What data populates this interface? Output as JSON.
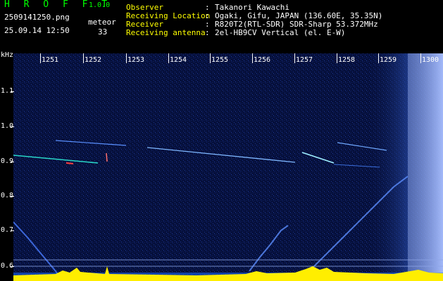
{
  "app": {
    "name": "H R O F F T",
    "version": "1.0.0"
  },
  "file": {
    "name": "2509141250.png",
    "datetime": "25.09.14 12:50"
  },
  "meteor": {
    "label": "meteor",
    "count": "33"
  },
  "info": [
    {
      "label": "Observer",
      "value": "Takanori Kawachi"
    },
    {
      "label": "Receiving Location",
      "value": "Ogaki, Gifu, JAPAN (136.60E, 35.35N)"
    },
    {
      "label": "Receiver",
      "value": "R820T2(RTL-SDR) SDR-Sharp 53.372MHz"
    },
    {
      "label": "Receiving antenna",
      "value": "2el-HB9CV Vertical (el. E-W)"
    }
  ],
  "axis": {
    "unit": "kHz",
    "y_ticks": [
      "1.1",
      "1.0",
      "0.9",
      "0.8",
      "0.7",
      "0.6"
    ],
    "x_ticks": [
      "1251",
      "1252",
      "1253",
      "1254",
      "1255",
      "1256",
      "1257",
      "1258",
      "1259",
      "1300"
    ]
  },
  "colors": {
    "title": "#00ff00",
    "label": "#ffff00",
    "text": "#ffffff",
    "background": "#000000",
    "spectro_bg": "#06103c"
  }
}
